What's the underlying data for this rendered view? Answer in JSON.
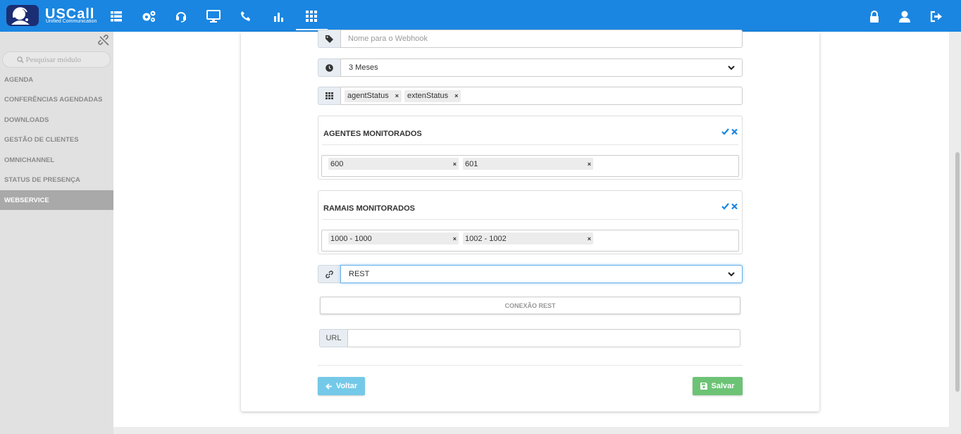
{
  "brand": {
    "name": "USCall",
    "subtitle": "Unified Communication"
  },
  "topnav": {
    "items": [
      {
        "icon": "list-icon"
      },
      {
        "icon": "cogs-icon"
      },
      {
        "icon": "headset-icon"
      },
      {
        "icon": "monitor-icon"
      },
      {
        "icon": "phone-icon"
      },
      {
        "icon": "bar-chart-icon"
      },
      {
        "icon": "grid-icon",
        "active": true
      }
    ],
    "right": [
      "lock-icon",
      "user-icon",
      "logout-icon"
    ]
  },
  "sidebar": {
    "search_placeholder": "Pesquisar módulo",
    "items": [
      {
        "label": "AGENDA"
      },
      {
        "label": "CONFERÊNCIAS AGENDADAS"
      },
      {
        "label": "DOWNLOADS"
      },
      {
        "label": "GESTÃO DE CLIENTES"
      },
      {
        "label": "OMNICHANNEL"
      },
      {
        "label": "STATUS DE PRESENÇA"
      },
      {
        "label": "WEBSERVICE",
        "active": true
      }
    ]
  },
  "form": {
    "name_placeholder": "Nome para o Webhook",
    "period_value": "3 Meses",
    "events": [
      "agentStatus",
      "extenStatus"
    ],
    "agents_panel": {
      "title": "AGENTES MONITORADOS",
      "tags": [
        "600",
        "601"
      ]
    },
    "extensions_panel": {
      "title": "RAMAIS MONITORADOS",
      "tags": [
        "1000 - 1000",
        "1002 - 1002"
      ]
    },
    "connection_type": "REST",
    "section_label": "CONEXÃO REST",
    "url_label": "URL",
    "url_value": "",
    "back_label": "Voltar",
    "save_label": "Salvar"
  },
  "colors": {
    "topbar": "#1a86e1",
    "sidebar_active": "#a9a9a9",
    "check": "#1a86e1",
    "back_button": "#74c9e8",
    "save_button": "#6cc375"
  }
}
